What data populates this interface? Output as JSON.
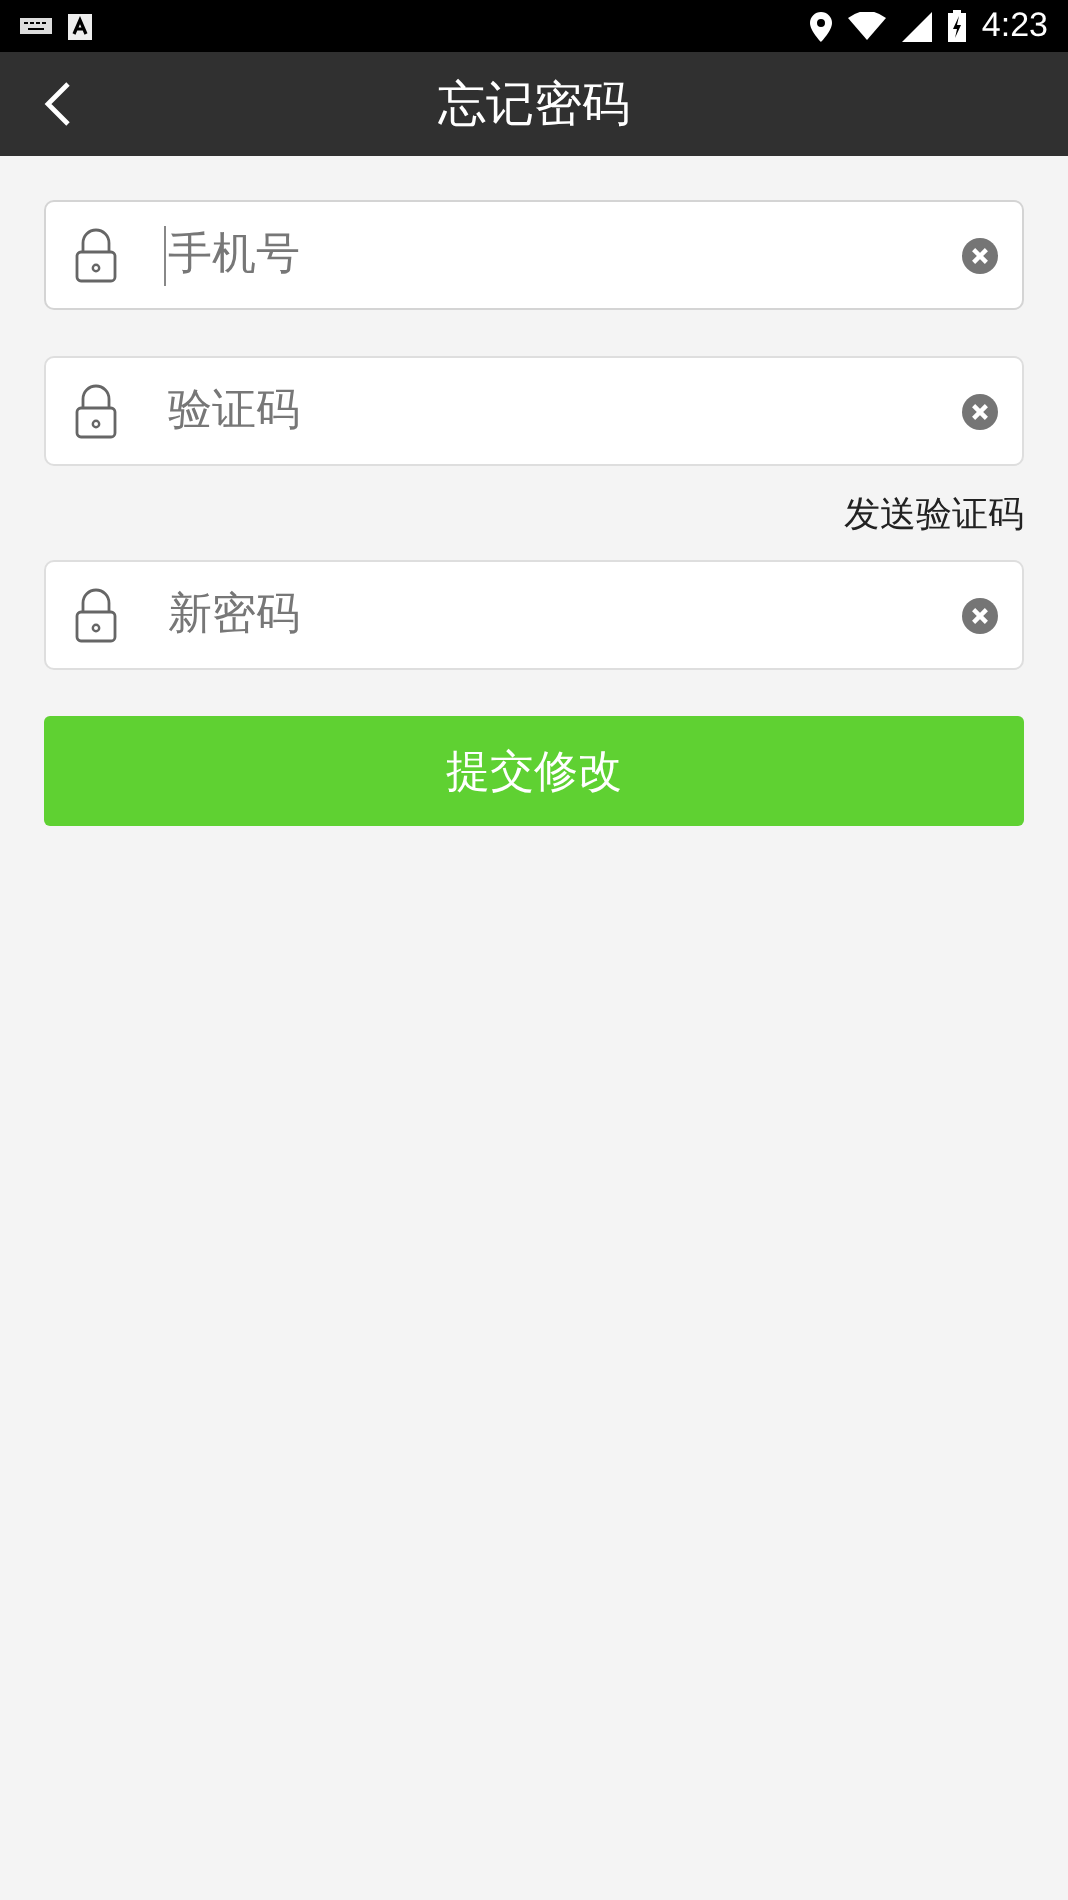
{
  "status_bar": {
    "time": "4:23"
  },
  "header": {
    "title": "忘记密码"
  },
  "fields": [
    {
      "placeholder": "手机号",
      "focused": true
    },
    {
      "placeholder": "验证码",
      "focused": false,
      "link": "发送验证码"
    },
    {
      "placeholder": "新密码",
      "focused": false
    }
  ],
  "submit_button": {
    "label": "提交修改"
  }
}
